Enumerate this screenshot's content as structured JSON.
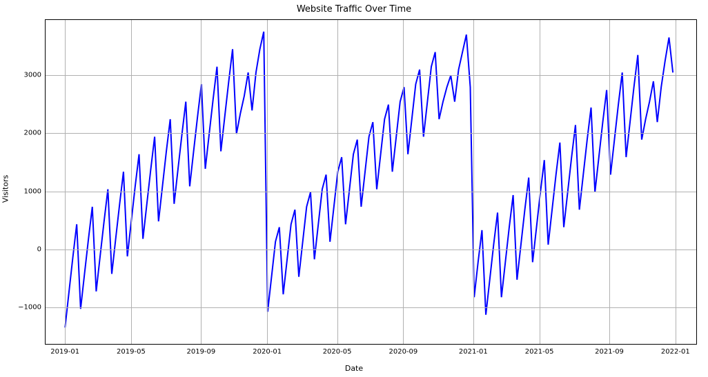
{
  "chart_data": {
    "type": "line",
    "title": "Website Traffic Over Time",
    "xlabel": "Date",
    "ylabel": "Visitors",
    "xlim": [
      -5,
      162
    ],
    "ylim": [
      -1600,
      3950
    ],
    "yticks": [
      {
        "v": -1000,
        "label": "−1000"
      },
      {
        "v": 0,
        "label": "0"
      },
      {
        "v": 1000,
        "label": "1000"
      },
      {
        "v": 2000,
        "label": "2000"
      },
      {
        "v": 3000,
        "label": "3000"
      }
    ],
    "xticks": [
      {
        "i": 0,
        "label": "2019-01"
      },
      {
        "i": 17,
        "label": "2019-05"
      },
      {
        "i": 35,
        "label": "2019-09"
      },
      {
        "i": 52,
        "label": "2020-01"
      },
      {
        "i": 70,
        "label": "2020-05"
      },
      {
        "i": 87,
        "label": "2020-09"
      },
      {
        "i": 105,
        "label": "2021-01"
      },
      {
        "i": 122,
        "label": "2021-05"
      },
      {
        "i": 140,
        "label": "2021-09"
      },
      {
        "i": 157,
        "label": "2022-01"
      }
    ],
    "series": [
      {
        "name": "Visitors",
        "color": "#0000ff",
        "y": [
          -1320,
          -720,
          -120,
          450,
          -1000,
          -400,
          190,
          750,
          -700,
          -100,
          490,
          1050,
          -400,
          200,
          790,
          1350,
          -100,
          500,
          1100,
          1650,
          200,
          800,
          1390,
          1950,
          500,
          1100,
          1700,
          2250,
          800,
          1400,
          1990,
          2550,
          1100,
          1700,
          2290,
          2850,
          1400,
          2000,
          2590,
          3150,
          1700,
          2300,
          2890,
          3450,
          2000,
          2350,
          2650,
          3050,
          2400,
          3050,
          3450,
          3750,
          -1050,
          -450,
          150,
          400,
          -750,
          -150,
          450,
          700,
          -450,
          150,
          750,
          1000,
          -150,
          450,
          1050,
          1300,
          150,
          750,
          1350,
          1600,
          450,
          1050,
          1650,
          1900,
          750,
          1350,
          1950,
          2200,
          1050,
          1650,
          2250,
          2500,
          1350,
          1950,
          2550,
          2800,
          1650,
          2250,
          2850,
          3100,
          1950,
          2550,
          3150,
          3400,
          2250,
          2550,
          2800,
          3000,
          2550,
          3100,
          3400,
          3700,
          2800,
          -800,
          -200,
          350,
          -1100,
          -500,
          100,
          650,
          -800,
          -200,
          400,
          950,
          -500,
          100,
          700,
          1250,
          -200,
          400,
          1000,
          1550,
          100,
          700,
          1300,
          1850,
          400,
          1000,
          1600,
          2150,
          700,
          1300,
          1900,
          2450,
          1000,
          1600,
          2200,
          2750,
          1300,
          1900,
          2500,
          3050,
          1600,
          2200,
          2800,
          3350,
          1900,
          2250,
          2550,
          2900,
          2200,
          2800,
          3250,
          3650,
          3050
        ]
      }
    ]
  }
}
